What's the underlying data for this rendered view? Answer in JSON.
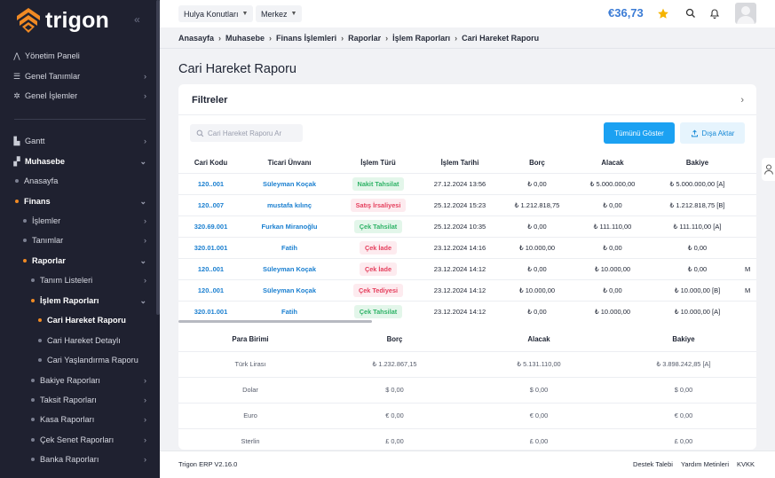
{
  "brand": {
    "name": "trigon"
  },
  "sidebar": {
    "top_items": [
      {
        "label": "Yönetim Paneli",
        "icon": "dashboard-icon"
      },
      {
        "label": "Genel Tanımlar",
        "icon": "sliders-icon"
      },
      {
        "label": "Genel İşlemler",
        "icon": "gears-icon"
      }
    ],
    "items": [
      {
        "label": "Gantt"
      },
      {
        "label": "Muhasebe"
      },
      {
        "label": "Anasayfa"
      },
      {
        "label": "Finans"
      },
      {
        "label": "İşlemler"
      },
      {
        "label": "Tanımlar"
      },
      {
        "label": "Raporlar"
      },
      {
        "label": "Tanım Listeleri"
      },
      {
        "label": "İşlem Raporları"
      },
      {
        "label": "Cari Hareket Raporu"
      },
      {
        "label": "Cari Hareket Detaylı"
      },
      {
        "label": "Cari Yaşlandırma Raporu"
      },
      {
        "label": "Bakiye Raporları"
      },
      {
        "label": "Taksit Raporları"
      },
      {
        "label": "Kasa Raporları"
      },
      {
        "label": "Çek Senet Raporları"
      },
      {
        "label": "Banka Raporları"
      }
    ]
  },
  "topbar": {
    "company": "Hulya Konutları",
    "branch": "Merkez",
    "balance": "€36,73"
  },
  "breadcrumb": [
    "Anasayfa",
    "Muhasebe",
    "Finans İşlemleri",
    "Raporlar",
    "İşlem Raporları",
    "Cari Hareket Raporu"
  ],
  "page_title": "Cari Hareket Raporu",
  "filters": {
    "title": "Filtreler",
    "search_placeholder": "Cari Hareket Raporu Ar",
    "show_all_label": "Tümünü Göster",
    "export_label": "Dışa Aktar"
  },
  "transactions": {
    "columns": [
      "Cari Kodu",
      "Ticari Ünvanı",
      "İşlem Türü",
      "İşlem Tarihi",
      "Borç",
      "Alacak",
      "Bakiye"
    ],
    "rows": [
      {
        "code": "120..001",
        "name": "Süleyman Koçak",
        "type": "Nakit Tahsilat",
        "type_color": "green",
        "date": "27.12.2024 13:56",
        "debt": "₺ 0,00",
        "credit": "₺ 5.000.000,00",
        "balance": "₺ 5.000.000,00 [A]",
        "extra": ""
      },
      {
        "code": "120..007",
        "name": "mustafa kılınç",
        "type": "Satış İrsaliyesi",
        "type_color": "red",
        "date": "25.12.2024 15:23",
        "debt": "₺ 1.212.818,75",
        "credit": "₺ 0,00",
        "balance": "₺ 1.212.818,75 [B]",
        "extra": ""
      },
      {
        "code": "320.69.001",
        "name": "Furkan Miranoğlu",
        "type": "Çek Tahsilat",
        "type_color": "green",
        "date": "25.12.2024 10:35",
        "debt": "₺ 0,00",
        "credit": "₺ 111.110,00",
        "balance": "₺ 111.110,00 [A]",
        "extra": ""
      },
      {
        "code": "320.01.001",
        "name": "Fatih",
        "type": "Çek İade",
        "type_color": "red",
        "date": "23.12.2024 14:16",
        "debt": "₺ 10.000,00",
        "credit": "₺ 0,00",
        "balance": "₺ 0,00",
        "extra": ""
      },
      {
        "code": "120..001",
        "name": "Süleyman Koçak",
        "type": "Çek İade",
        "type_color": "red",
        "date": "23.12.2024 14:12",
        "debt": "₺ 0,00",
        "credit": "₺ 10.000,00",
        "balance": "₺ 0,00",
        "extra": "M"
      },
      {
        "code": "120..001",
        "name": "Süleyman Koçak",
        "type": "Çek Tediyesi",
        "type_color": "red",
        "date": "23.12.2024 14:12",
        "debt": "₺ 10.000,00",
        "credit": "₺ 0,00",
        "balance": "₺ 10.000,00 [B]",
        "extra": "M"
      },
      {
        "code": "320.01.001",
        "name": "Fatih",
        "type": "Çek Tahsilat",
        "type_color": "green",
        "date": "23.12.2024 14:12",
        "debt": "₺ 0,00",
        "credit": "₺ 10.000,00",
        "balance": "₺ 10.000,00 [A]",
        "extra": ""
      }
    ]
  },
  "summary": {
    "columns": [
      "Para Birimi",
      "Borç",
      "Alacak",
      "Bakiye"
    ],
    "rows": [
      {
        "currency": "Türk Lirası",
        "debt": "₺ 1.232.867,15",
        "credit": "₺ 5.131.110,00",
        "balance": "₺ 3.898.242,85 [A]"
      },
      {
        "currency": "Dolar",
        "debt": "$ 0,00",
        "credit": "$ 0,00",
        "balance": "$ 0,00"
      },
      {
        "currency": "Euro",
        "debt": "€ 0,00",
        "credit": "€ 0,00",
        "balance": "€ 0,00"
      },
      {
        "currency": "Sterlin",
        "debt": "£ 0,00",
        "credit": "£ 0,00",
        "balance": "£ 0,00"
      }
    ]
  },
  "footer": {
    "version": "Trigon ERP V2.16.0",
    "links": [
      "Destek Talebi",
      "Yardım Metinleri",
      "KVKK"
    ]
  },
  "colors": {
    "sidebar_bg": "#1f2130",
    "accent_orange": "#f08a24",
    "primary_blue": "#1ba1f2",
    "link_blue": "#1a7fd0",
    "badge_green": "#2fb367",
    "badge_red": "#e5405e"
  }
}
